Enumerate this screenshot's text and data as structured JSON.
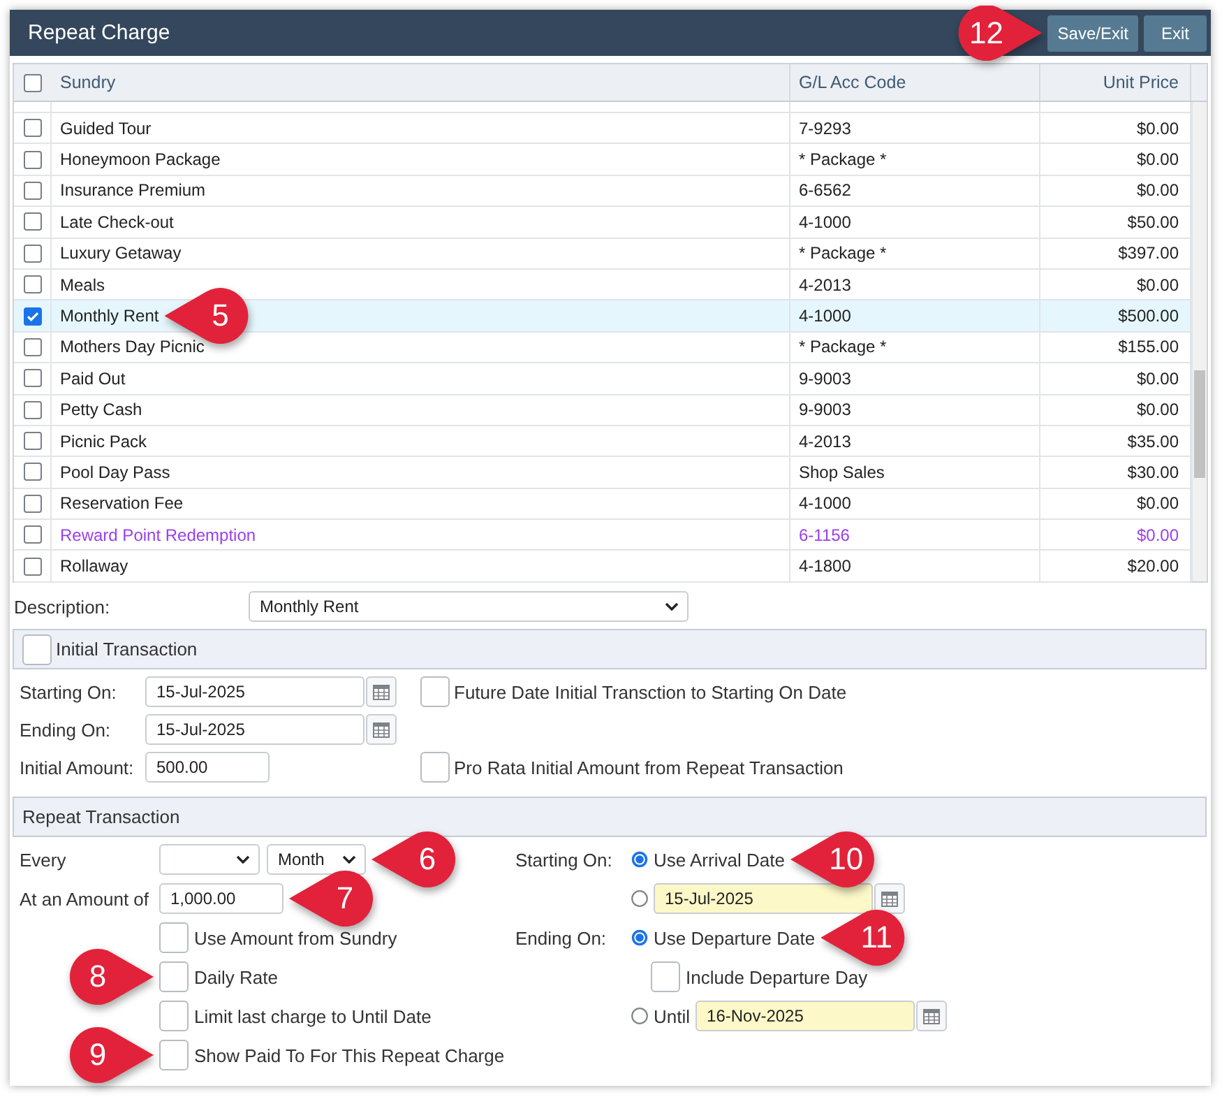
{
  "window": {
    "title": "Repeat Charge",
    "buttons": [
      {
        "label": "Save/Exit",
        "callout": {
          "number": "12",
          "points_right": true
        }
      },
      {
        "label": "Exit"
      }
    ]
  },
  "table": {
    "select_all": {
      "checked": false
    },
    "columns": [
      "Sundry",
      "G/L Acc Code",
      "Unit Price"
    ],
    "rows": [
      {
        "checked": false,
        "selected": false,
        "color": "#222222",
        "cells": [
          "Guided Tour",
          "7-9293",
          "$0.00"
        ]
      },
      {
        "checked": false,
        "selected": false,
        "color": "#222222",
        "cells": [
          "Honeymoon Package",
          "* Package *",
          "$0.00"
        ]
      },
      {
        "checked": false,
        "selected": false,
        "color": "#222222",
        "cells": [
          "Insurance Premium",
          "6-6562",
          "$0.00"
        ]
      },
      {
        "checked": false,
        "selected": false,
        "color": "#222222",
        "cells": [
          "Late Check-out",
          "4-1000",
          "$50.00"
        ]
      },
      {
        "checked": false,
        "selected": false,
        "color": "#222222",
        "cells": [
          "Luxury Getaway",
          "* Package *",
          "$397.00"
        ]
      },
      {
        "checked": false,
        "selected": false,
        "color": "#222222",
        "cells": [
          "Meals",
          "4-2013",
          "$0.00"
        ]
      },
      {
        "checked": true,
        "selected": true,
        "color": "#222222",
        "cells": [
          "Monthly Rent",
          "4-1000",
          "$500.00"
        ],
        "callout": {
          "number": "5",
          "points_right": false
        }
      },
      {
        "checked": false,
        "selected": false,
        "color": "#222222",
        "cells": [
          "Mothers Day Picnic",
          "* Package *",
          "$155.00"
        ]
      },
      {
        "checked": false,
        "selected": false,
        "color": "#222222",
        "cells": [
          "Paid Out",
          "9-9003",
          "$0.00"
        ]
      },
      {
        "checked": false,
        "selected": false,
        "color": "#222222",
        "cells": [
          "Petty Cash",
          "9-9003",
          "$0.00"
        ]
      },
      {
        "checked": false,
        "selected": false,
        "color": "#222222",
        "cells": [
          "Picnic Pack",
          "4-2013",
          "$35.00"
        ]
      },
      {
        "checked": false,
        "selected": false,
        "color": "#222222",
        "cells": [
          "Pool Day Pass",
          "Shop Sales",
          "$30.00"
        ]
      },
      {
        "checked": false,
        "selected": false,
        "color": "#222222",
        "cells": [
          "Reservation Fee",
          "4-1000",
          "$0.00"
        ]
      },
      {
        "checked": false,
        "selected": false,
        "color": "#9a40ec",
        "cells": [
          "Reward Point Redemption",
          "6-1156",
          "$0.00"
        ]
      },
      {
        "checked": false,
        "selected": false,
        "color": "#222222",
        "cells": [
          "Rollaway",
          "4-1800",
          "$20.00"
        ]
      }
    ]
  },
  "description": {
    "label": "Description:",
    "value": "Monthly Rent"
  },
  "initial_transaction": {
    "title": "Initial Transaction",
    "checked": false,
    "fields": [
      {
        "kind": "date",
        "label": "Starting On:",
        "value": "15-Jul-2025",
        "option": {
          "label": "Future Date Initial Transction to Starting On Date",
          "checked": false
        }
      },
      {
        "kind": "date",
        "label": "Ending On:",
        "value": "15-Jul-2025"
      },
      {
        "kind": "amount",
        "label": "Initial Amount:",
        "value": "500.00",
        "option": {
          "label": "Pro Rata Initial Amount from Repeat Transaction",
          "checked": false
        }
      }
    ]
  },
  "repeat_transaction": {
    "title": "Repeat Transaction",
    "every": {
      "label": "Every",
      "unit": "Month",
      "callout": {
        "number": "6",
        "points_right": false
      }
    },
    "amount": {
      "label": "At an Amount of",
      "value": "1,000.00",
      "callout": {
        "number": "7",
        "points_right": false
      }
    },
    "options": [
      {
        "label": "Use Amount from Sundry",
        "checked": false
      },
      {
        "label": "Daily Rate",
        "checked": false,
        "callout": {
          "number": "8",
          "points_right": true
        }
      },
      {
        "label": "Limit last charge to Until Date",
        "checked": false
      },
      {
        "label": "Show Paid To For This Repeat Charge",
        "checked": false,
        "callout": {
          "number": "9",
          "points_right": true
        }
      }
    ],
    "starting_on": {
      "label": "Starting On:",
      "choices": [
        {
          "kind": "radio",
          "label": "Use Arrival Date",
          "selected": true,
          "callout": {
            "number": "10",
            "points_right": false
          }
        },
        {
          "kind": "radio-date",
          "value": "15-Jul-2025",
          "selected": false
        }
      ]
    },
    "ending_on": {
      "label": "Ending On:",
      "choices": [
        {
          "kind": "radio",
          "label": "Use Departure Date",
          "selected": true,
          "callout": {
            "number": "11",
            "points_right": false
          }
        },
        {
          "kind": "checkbox",
          "label": "Include Departure Day",
          "checked": false
        },
        {
          "kind": "radio-date",
          "label": "Until",
          "value": "16-Nov-2025",
          "selected": false
        }
      ]
    }
  }
}
